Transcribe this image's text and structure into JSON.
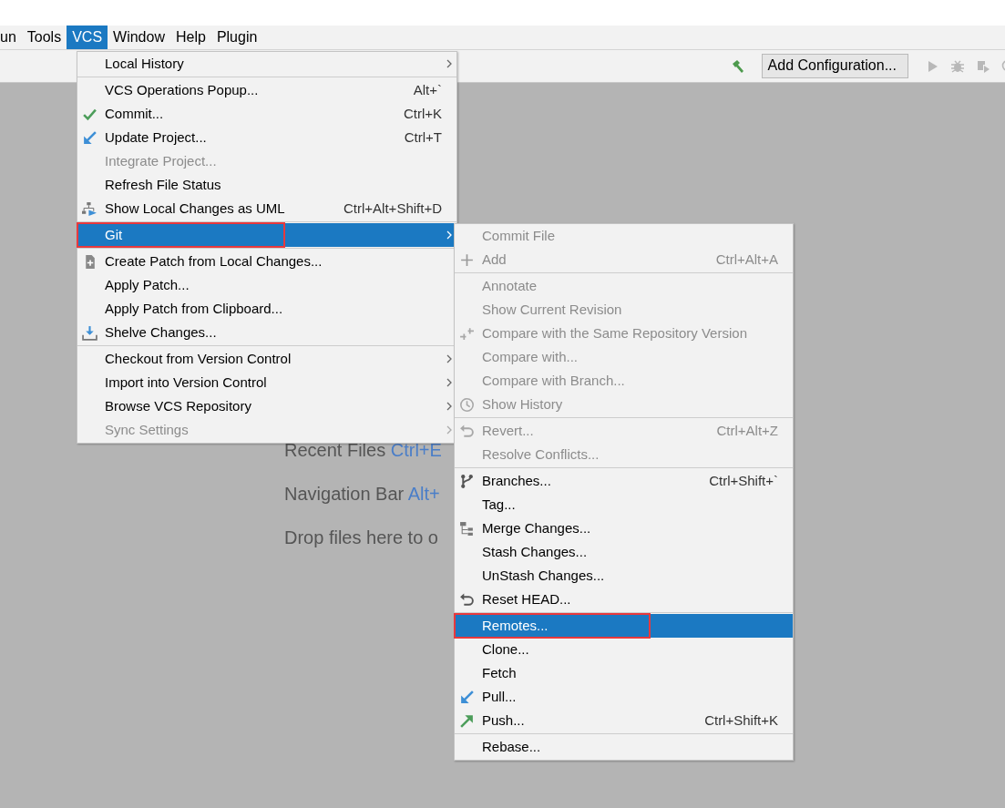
{
  "menubar": [
    {
      "label": "un",
      "selected": false
    },
    {
      "label": "Tools",
      "selected": false
    },
    {
      "label": "VCS",
      "selected": true
    },
    {
      "label": "Window",
      "selected": false
    },
    {
      "label": "Help",
      "selected": false
    },
    {
      "label": "Plugin",
      "selected": false
    }
  ],
  "toolbar": {
    "button": "Add Configuration..."
  },
  "background_hints": [
    {
      "text": "Recent Files",
      "shortcut": "Ctrl+E"
    },
    {
      "text": "Navigation Bar",
      "shortcut": "Alt+"
    },
    {
      "text": "Drop files here to o"
    }
  ],
  "vcs_menu": [
    {
      "kind": "item",
      "label": "Local History",
      "disabled": false,
      "selected": false,
      "submenu": true,
      "annotated": false
    },
    {
      "kind": "separator"
    },
    {
      "kind": "item",
      "label": "VCS Operations Popup...",
      "shortcut": "Alt+`",
      "disabled": false,
      "selected": false,
      "submenu": false,
      "annotated": false
    },
    {
      "kind": "check",
      "label": "Commit...",
      "shortcut": "Ctrl+K",
      "disabled": false,
      "selected": false,
      "submenu": false,
      "annotated": false
    },
    {
      "kind": "update",
      "label": "Update Project...",
      "shortcut": "Ctrl+T",
      "disabled": false,
      "selected": false,
      "submenu": false,
      "annotated": false
    },
    {
      "kind": "item",
      "label": "Integrate Project...",
      "disabled": true,
      "selected": false,
      "submenu": false,
      "annotated": false
    },
    {
      "kind": "item",
      "label": "Refresh File Status",
      "disabled": false,
      "selected": false,
      "submenu": false,
      "annotated": false
    },
    {
      "kind": "uml",
      "label": "Show Local Changes as UML",
      "shortcut": "Ctrl+Alt+Shift+D",
      "disabled": false,
      "selected": false,
      "submenu": false,
      "annotated": false
    },
    {
      "kind": "separator"
    },
    {
      "kind": "item",
      "label": "Git",
      "disabled": false,
      "selected": true,
      "submenu": true,
      "annotated": true
    },
    {
      "kind": "separator"
    },
    {
      "kind": "patch",
      "label": "Create Patch from Local Changes...",
      "disabled": false,
      "selected": false,
      "submenu": false,
      "annotated": false
    },
    {
      "kind": "item",
      "label": "Apply Patch...",
      "disabled": false,
      "selected": false,
      "submenu": false,
      "annotated": false
    },
    {
      "kind": "item",
      "label": "Apply Patch from Clipboard...",
      "disabled": false,
      "selected": false,
      "submenu": false,
      "annotated": false
    },
    {
      "kind": "shelve",
      "label": "Shelve Changes...",
      "disabled": false,
      "selected": false,
      "submenu": false,
      "annotated": false
    },
    {
      "kind": "separator"
    },
    {
      "kind": "item",
      "label": "Checkout from Version Control",
      "disabled": false,
      "selected": false,
      "submenu": true,
      "annotated": false
    },
    {
      "kind": "item",
      "label": "Import into Version Control",
      "disabled": false,
      "selected": false,
      "submenu": true,
      "annotated": false
    },
    {
      "kind": "item",
      "label": "Browse VCS Repository",
      "disabled": false,
      "selected": false,
      "submenu": true,
      "annotated": false
    },
    {
      "kind": "item",
      "label": "Sync Settings",
      "disabled": true,
      "selected": false,
      "submenu": true,
      "annotated": false
    }
  ],
  "git_submenu": [
    {
      "kind": "item",
      "label": "Commit File",
      "disabled": true,
      "selected": false,
      "annotated": false
    },
    {
      "kind": "plus",
      "label": "Add",
      "shortcut": "Ctrl+Alt+A",
      "disabled": true,
      "selected": false,
      "annotated": false
    },
    {
      "kind": "separator"
    },
    {
      "kind": "item",
      "label": "Annotate",
      "disabled": true,
      "selected": false,
      "annotated": false
    },
    {
      "kind": "item",
      "label": "Show Current Revision",
      "disabled": true,
      "selected": false,
      "annotated": false
    },
    {
      "kind": "compare",
      "label": "Compare with the Same Repository Version",
      "disabled": true,
      "selected": false,
      "annotated": false
    },
    {
      "kind": "item",
      "label": "Compare with...",
      "disabled": true,
      "selected": false,
      "annotated": false
    },
    {
      "kind": "item",
      "label": "Compare with Branch...",
      "disabled": true,
      "selected": false,
      "annotated": false
    },
    {
      "kind": "history",
      "label": "Show History",
      "disabled": true,
      "selected": false,
      "annotated": false
    },
    {
      "kind": "separator"
    },
    {
      "kind": "revert",
      "label": "Revert...",
      "shortcut": "Ctrl+Alt+Z",
      "disabled": true,
      "selected": false,
      "annotated": false
    },
    {
      "kind": "item",
      "label": "Resolve Conflicts...",
      "disabled": true,
      "selected": false,
      "annotated": false
    },
    {
      "kind": "separator"
    },
    {
      "kind": "branches",
      "label": "Branches...",
      "shortcut": "Ctrl+Shift+`",
      "disabled": false,
      "selected": false,
      "annotated": false
    },
    {
      "kind": "item",
      "label": "Tag...",
      "disabled": false,
      "selected": false,
      "annotated": false
    },
    {
      "kind": "merge",
      "label": "Merge Changes...",
      "disabled": false,
      "selected": false,
      "annotated": false
    },
    {
      "kind": "item",
      "label": "Stash Changes...",
      "disabled": false,
      "selected": false,
      "annotated": false
    },
    {
      "kind": "item",
      "label": "UnStash Changes...",
      "disabled": false,
      "selected": false,
      "annotated": false
    },
    {
      "kind": "revert",
      "label": "Reset HEAD...",
      "disabled": false,
      "selected": false,
      "annotated": false
    },
    {
      "kind": "separator"
    },
    {
      "kind": "item",
      "label": "Remotes...",
      "disabled": false,
      "selected": true,
      "annotated": true
    },
    {
      "kind": "item",
      "label": "Clone...",
      "disabled": false,
      "selected": false,
      "annotated": false
    },
    {
      "kind": "item",
      "label": "Fetch",
      "disabled": false,
      "selected": false,
      "annotated": false
    },
    {
      "kind": "update",
      "label": "Pull...",
      "disabled": false,
      "selected": false,
      "annotated": false
    },
    {
      "kind": "push",
      "label": "Push...",
      "shortcut": "Ctrl+Shift+K",
      "disabled": false,
      "selected": false,
      "annotated": false
    },
    {
      "kind": "separator"
    },
    {
      "kind": "item",
      "label": "Rebase...",
      "disabled": false,
      "selected": false,
      "annotated": false
    }
  ]
}
